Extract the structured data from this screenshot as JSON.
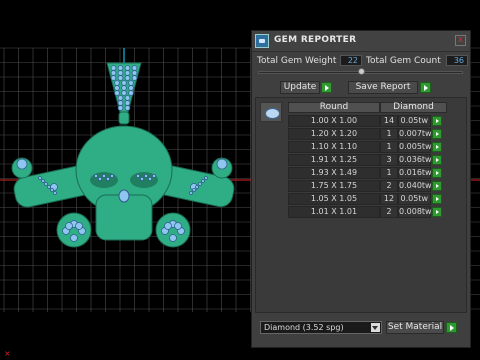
{
  "panel": {
    "title": "GEM REPORTER",
    "close_label": "x",
    "total_gem_weight_label": "Total Gem Weight",
    "total_gem_weight_value": "22",
    "total_gem_count_label": "Total Gem Count",
    "total_gem_count_value": "36",
    "update_label": "Update",
    "save_report_label": "Save Report",
    "table": {
      "header_shape": "Round",
      "header_material": "Diamond",
      "rows": [
        {
          "size": "1.00 X 1.00",
          "count": "14",
          "weight": "0.05tw"
        },
        {
          "size": "1.20 X 1.20",
          "count": "1",
          "weight": "0.007tw"
        },
        {
          "size": "1.10 X 1.10",
          "count": "1",
          "weight": "0.005tw"
        },
        {
          "size": "1.91 X 1.25",
          "count": "3",
          "weight": "0.036tw"
        },
        {
          "size": "1.93 X 1.49",
          "count": "1",
          "weight": "0.016tw"
        },
        {
          "size": "1.75 X 1.75",
          "count": "2",
          "weight": "0.040tw"
        },
        {
          "size": "1.05 X 1.05",
          "count": "12",
          "weight": "0.05tw"
        },
        {
          "size": "1.01 X 1.01",
          "count": "2",
          "weight": "0.008tw"
        }
      ]
    },
    "material_select": "Diamond    (3.52 spg)",
    "set_material_label": "Set Material"
  },
  "colors": {
    "model": "#2fae86",
    "model_dark": "#1f7f60",
    "gem": "#8fc6f0",
    "grid": "#5a5a5a",
    "axis_red": "#d22",
    "axis_cyan": "#1bd"
  }
}
